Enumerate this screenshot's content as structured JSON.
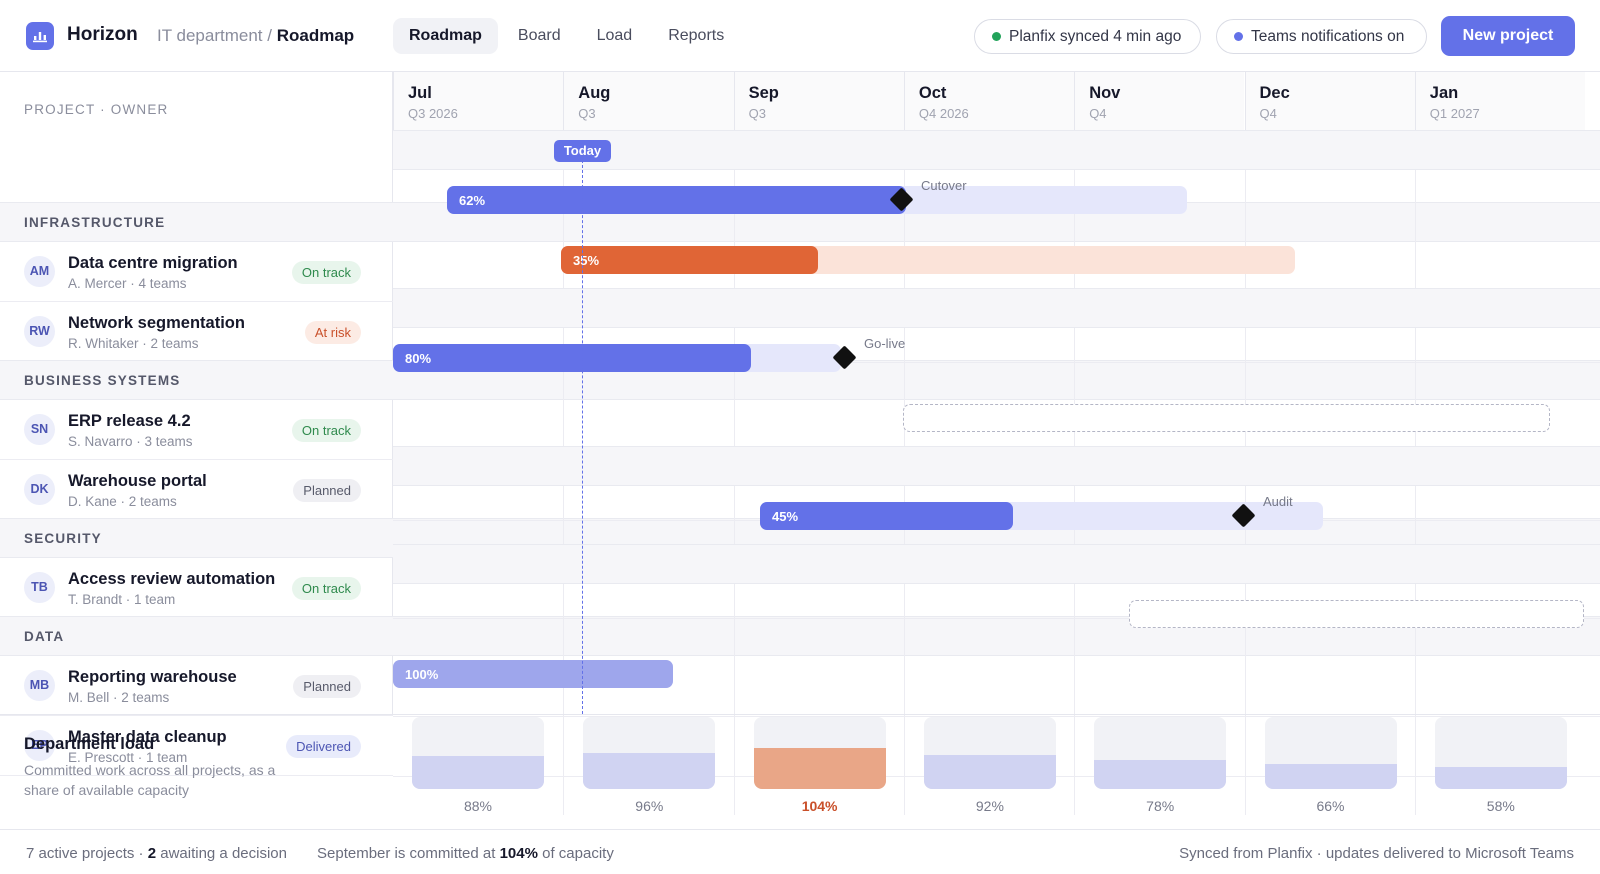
{
  "app": {
    "name": "Horizon",
    "icon": "chart-bars-icon"
  },
  "breadcrumb": {
    "parent": "IT department",
    "separator": " / ",
    "current": "Roadmap"
  },
  "nav": [
    {
      "label": "Roadmap",
      "active": true
    },
    {
      "label": "Board",
      "active": false
    },
    {
      "label": "Load",
      "active": false
    },
    {
      "label": "Reports",
      "active": false
    }
  ],
  "status": {
    "sync": {
      "label": "Planfix synced 4 min ago",
      "color": "#22a35a"
    },
    "teams": {
      "label": "Teams notifications on",
      "color": "#6371e8"
    }
  },
  "actions": {
    "new_project": "New project"
  },
  "columns": {
    "project_header": "PROJECT · OWNER"
  },
  "months": [
    {
      "name": "Jul",
      "quarter": "Q3 2026"
    },
    {
      "name": "Aug",
      "quarter": "Q3"
    },
    {
      "name": "Sep",
      "quarter": "Q3"
    },
    {
      "name": "Oct",
      "quarter": "Q4 2026"
    },
    {
      "name": "Nov",
      "quarter": "Q4"
    },
    {
      "name": "Dec",
      "quarter": "Q4"
    },
    {
      "name": "Jan",
      "quarter": "Q1 2027"
    }
  ],
  "today": {
    "label": "Today"
  },
  "colors": {
    "accent": "#6371e8",
    "accent_light": "#e5e7fb",
    "risk": "#e06536",
    "risk_light": "#fbe3d9",
    "delivered": "#9ea6ec"
  },
  "groups": [
    {
      "label": "INFRASTRUCTURE",
      "projects": [
        {
          "initials": "AM",
          "name": "Data centre migration",
          "meta": "A. Mercer · 4 teams",
          "status": "On track",
          "status_kind": "ontrack",
          "progress_label": "62%",
          "milestone": "Cutover"
        },
        {
          "initials": "RW",
          "name": "Network segmentation",
          "meta": "R. Whitaker · 2 teams",
          "status": "At risk",
          "status_kind": "atrisk",
          "progress_label": "35%"
        }
      ]
    },
    {
      "label": "BUSINESS SYSTEMS",
      "projects": [
        {
          "initials": "SN",
          "name": "ERP release 4.2",
          "meta": "S. Navarro · 3 teams",
          "status": "On track",
          "status_kind": "ontrack",
          "progress_label": "80%",
          "milestone": "Go-live"
        },
        {
          "initials": "DK",
          "name": "Warehouse portal",
          "meta": "D. Kane · 2 teams",
          "status": "Planned",
          "status_kind": "planned"
        }
      ]
    },
    {
      "label": "SECURITY",
      "projects": [
        {
          "initials": "TB",
          "name": "Access review automation",
          "meta": "T. Brandt · 1 team",
          "status": "On track",
          "status_kind": "ontrack",
          "progress_label": "45%",
          "milestone": "Audit"
        }
      ]
    },
    {
      "label": "DATA",
      "projects": [
        {
          "initials": "MB",
          "name": "Reporting warehouse",
          "meta": "M. Bell · 2 teams",
          "status": "Planned",
          "status_kind": "planned"
        },
        {
          "initials": "EP",
          "name": "Master data cleanup",
          "meta": "E. Prescott · 1 team",
          "status": "Delivered",
          "status_kind": "delivered",
          "progress_label": "100%"
        }
      ]
    }
  ],
  "load": {
    "title": "Department load",
    "subtitle": "Committed work across all projects, as a share of available capacity",
    "months": [
      {
        "label": "88%",
        "value": 88
      },
      {
        "label": "96%",
        "value": 96
      },
      {
        "label": "104%",
        "value": 104,
        "over": true
      },
      {
        "label": "92%",
        "value": 92
      },
      {
        "label": "78%",
        "value": 78
      },
      {
        "label": "66%",
        "value": 66
      },
      {
        "label": "58%",
        "value": 58
      }
    ]
  },
  "footer": {
    "active_count": "7",
    "active_text": " active projects · ",
    "awaiting_count": "2",
    "awaiting_text": " awaiting a decision",
    "committed_pre": "September is committed at ",
    "committed_val": "104%",
    "committed_post": " of capacity",
    "right": "Synced from Planfix · updates delivered to Microsoft Teams"
  }
}
